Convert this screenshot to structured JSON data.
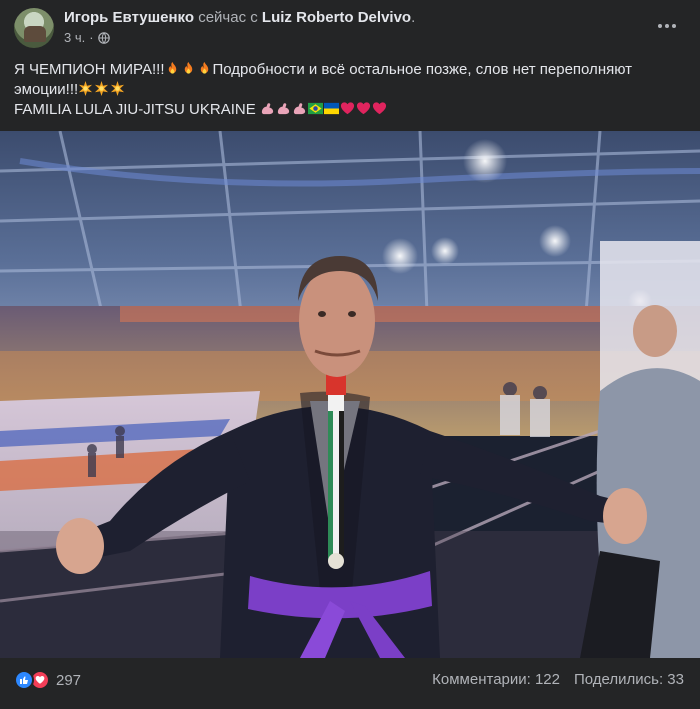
{
  "post": {
    "author": "Игорь Евтушенко",
    "with_text": "сейчас с",
    "tagged": "Luiz Roberto Delvivo",
    "tagged_suffix": ".",
    "time": "3 ч.",
    "time_sep": "·",
    "text": {
      "line1_start": "Я ЧЕМПИОН МИРА!!!",
      "line1_end": "Подробности и всё остальное позже, слов нет переполняют",
      "line2": "эмоции!!!",
      "line3": "FAMILIA LULA JIU-JITSU UKRAINE"
    },
    "emojis": {
      "fire": "fire-emoji",
      "sparkle": "collision-emoji",
      "arm": "flexed-biceps-emoji",
      "brazil": "brazil-flag-emoji",
      "ukraine": "ukraine-flag-emoji",
      "heart": "red-heart-emoji"
    }
  },
  "photo": {
    "description_icon": "photo"
  },
  "footer": {
    "reaction_count": "297",
    "comments": "Комментарии: 122",
    "shares": "Поделились: 33"
  },
  "colors": {
    "background": "#242526",
    "text_primary": "#e4e6eb",
    "text_secondary": "#b0b3b8",
    "like_blue": "#2d88ff",
    "love_red": "#f33e58"
  }
}
